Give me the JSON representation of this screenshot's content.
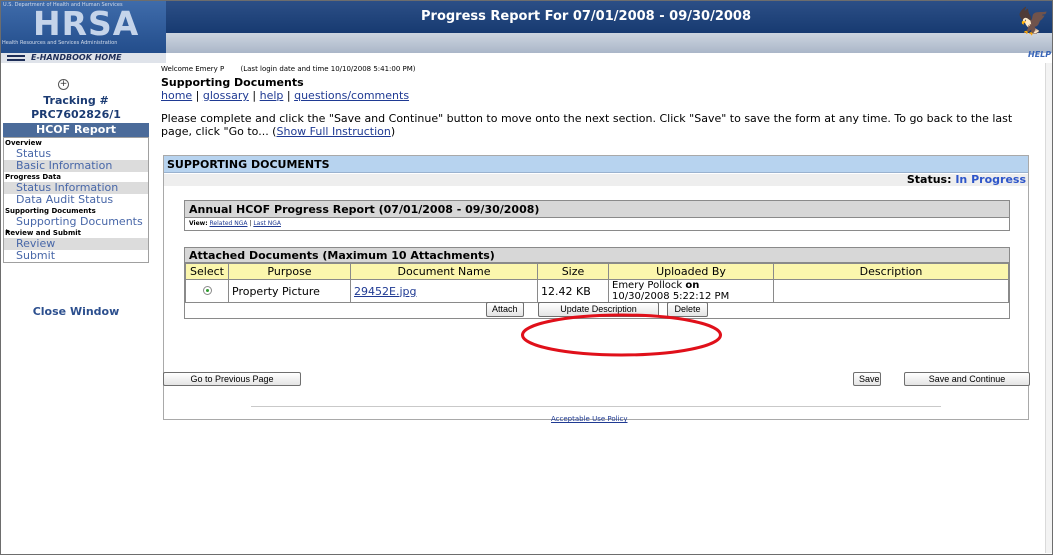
{
  "header": {
    "agency_small": "U.S. Department of Health and Human Services",
    "logo": "HRSA",
    "logo_sub": "Health Resources and Services Administration",
    "handbook_home": "E-HANDBOOK HOME",
    "title": "Progress Report For 07/01/2008 - 09/30/2008",
    "help": "HELP",
    "hhs_icon": "hhs-eagle-icon"
  },
  "sidebar": {
    "tracking_label": "Tracking #",
    "tracking_number": "PRC7602826/1",
    "report_title": "HCOF Report",
    "groups": [
      {
        "label": "Overview",
        "items": [
          "Status",
          "Basic Information"
        ]
      },
      {
        "label": "Progress Data",
        "items": [
          "Status Information",
          "Data Audit Status"
        ]
      },
      {
        "label": "Supporting Documents",
        "items": [
          "Supporting Documents"
        ]
      },
      {
        "label": "Review and Submit",
        "items": [
          "Review",
          "Submit"
        ]
      }
    ],
    "close_window": "Close Window"
  },
  "main": {
    "welcome": "Welcome Emery P",
    "last_login": "(Last login date and time 10/10/2008 5:41:00 PM)",
    "page_title": "Supporting Documents",
    "links": {
      "home": "home",
      "glossary": "glossary",
      "help": "help",
      "questions": "questions/comments",
      "separator": " | "
    },
    "instructions_text": "Please complete and click the \"Save and Continue\" button to move onto the next section. Click \"Save\" to save the form at any time. To go back to the last page, click \"Go to... (",
    "instructions_link": "Show Full Instruction",
    "instructions_end": ")",
    "panel_title": "SUPPORTING DOCUMENTS",
    "status_label": "Status:",
    "status_value": "In Progress",
    "annual": {
      "title": "Annual HCOF Progress Report (07/01/2008 - 09/30/2008)",
      "view_label": "View:",
      "related_nga": "Related NGA",
      "last_nga": "Last NGA",
      "separator": " | "
    },
    "attachments": {
      "title": "Attached Documents (Maximum 10 Attachments)",
      "columns": [
        "Select",
        "Purpose",
        "Document Name",
        "Size",
        "Uploaded By",
        "Description"
      ],
      "rows": [
        {
          "purpose": "Property Picture",
          "document_name": "29452E.jpg",
          "size": "12.42 KB",
          "uploaded_by": "Emery Pollock",
          "uploaded_on_label": "on",
          "uploaded_date": "10/30/2008 5:22:12 PM",
          "description": ""
        }
      ],
      "buttons": {
        "attach": "Attach",
        "update_description": "Update Description",
        "delete": "Delete"
      }
    },
    "nav_buttons": {
      "previous": "Go to Previous Page",
      "save": "Save",
      "save_continue": "Save and Continue"
    },
    "footer_link": "Acceptable Use Policy"
  },
  "colors": {
    "header_blue": "#173a71",
    "panel_header": "#b7d3ef",
    "table_header": "#fbf6ad",
    "status_value": "#2d55c9",
    "highlight": "#e0101a"
  }
}
